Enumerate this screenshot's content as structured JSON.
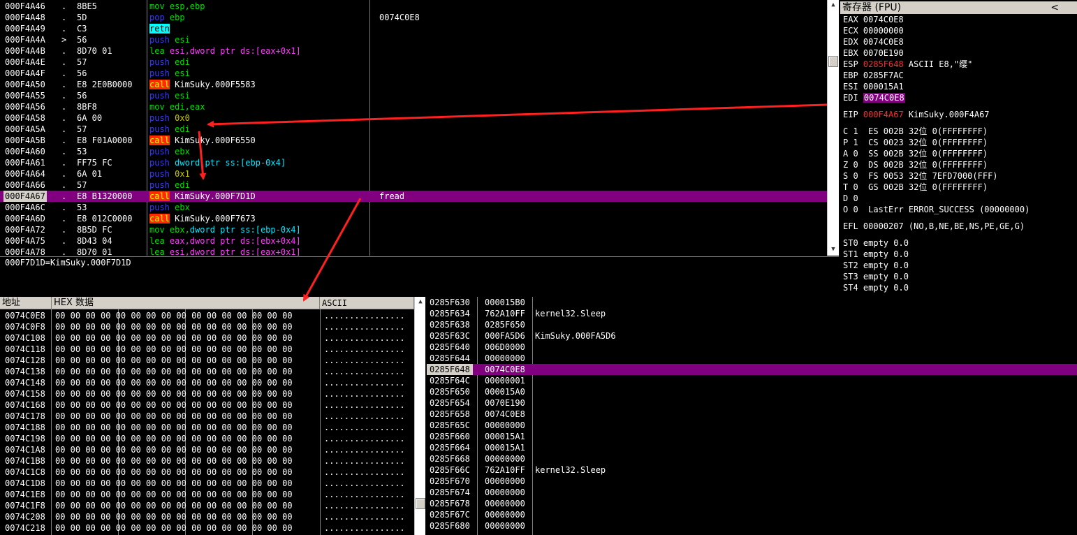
{
  "disasm": {
    "rows": [
      {
        "addr": "000F4A46",
        "mark": ".",
        "hex": "8BE5",
        "ins": [
          {
            "t": "mov esp,ebp",
            "c": "kw-g"
          }
        ],
        "comment": ""
      },
      {
        "addr": "000F4A48",
        "mark": ".",
        "hex": "5D",
        "ins": [
          {
            "t": "pop ebp",
            "c": "kw-b",
            "split": true
          }
        ],
        "comment": "0074C0E8"
      },
      {
        "addr": "000F4A49",
        "mark": ".",
        "hex": "C3",
        "ins": [
          {
            "t": "retn",
            "c": "retn-hl"
          }
        ],
        "comment": ""
      },
      {
        "addr": "000F4A4A",
        "mark": ">",
        "hex": "56",
        "ins": [
          {
            "t": "push esi",
            "c": "kw-b",
            "split": true
          }
        ],
        "comment": ""
      },
      {
        "addr": "000F4A4B",
        "mark": ".",
        "hex": "8D70 01",
        "ins": [
          {
            "t": "lea esi,dword ptr ds:[eax+0x1]",
            "c": "kw-m"
          }
        ],
        "comment": ""
      },
      {
        "addr": "000F4A4E",
        "mark": ".",
        "hex": "57",
        "ins": [
          {
            "t": "push edi",
            "c": "kw-b",
            "split": true
          }
        ],
        "comment": ""
      },
      {
        "addr": "000F4A4F",
        "mark": ".",
        "hex": "56",
        "ins": [
          {
            "t": "push esi",
            "c": "kw-b",
            "split": true
          }
        ],
        "comment": ""
      },
      {
        "addr": "000F4A50",
        "mark": ".",
        "hex": "E8 2E0B0000",
        "ins": [
          {
            "t": "call",
            "c": "call-hl"
          },
          {
            "t": " KimSuky.000F5583",
            "c": ""
          }
        ],
        "comment": ""
      },
      {
        "addr": "000F4A55",
        "mark": ".",
        "hex": "56",
        "ins": [
          {
            "t": "push esi",
            "c": "kw-b",
            "split": true
          }
        ],
        "comment": ""
      },
      {
        "addr": "000F4A56",
        "mark": ".",
        "hex": "8BF8",
        "ins": [
          {
            "t": "mov edi,eax",
            "c": "kw-g"
          }
        ],
        "comment": ""
      },
      {
        "addr": "000F4A58",
        "mark": ".",
        "hex": "6A 00",
        "ins": [
          {
            "t": "push ",
            "c": "kw-b"
          },
          {
            "t": "0x0",
            "c": "kw-y"
          }
        ],
        "comment": ""
      },
      {
        "addr": "000F4A5A",
        "mark": ".",
        "hex": "57",
        "ins": [
          {
            "t": "push edi",
            "c": "kw-b",
            "split": true
          }
        ],
        "comment": ""
      },
      {
        "addr": "000F4A5B",
        "mark": ".",
        "hex": "E8 F01A0000",
        "ins": [
          {
            "t": "call",
            "c": "call-hl"
          },
          {
            "t": " KimSuky.000F6550",
            "c": ""
          }
        ],
        "comment": ""
      },
      {
        "addr": "000F4A60",
        "mark": ".",
        "hex": "53",
        "ins": [
          {
            "t": "push ebx",
            "c": "kw-b",
            "split": true
          }
        ],
        "comment": ""
      },
      {
        "addr": "000F4A61",
        "mark": ".",
        "hex": "FF75 FC",
        "ins": [
          {
            "t": "push ",
            "c": "kw-b"
          },
          {
            "t": "dword ptr ss:[ebp-0x4]",
            "c": "kw-c"
          }
        ],
        "comment": ""
      },
      {
        "addr": "000F4A64",
        "mark": ".",
        "hex": "6A 01",
        "ins": [
          {
            "t": "push ",
            "c": "kw-b"
          },
          {
            "t": "0x1",
            "c": "kw-y"
          }
        ],
        "comment": ""
      },
      {
        "addr": "000F4A66",
        "mark": ".",
        "hex": "57",
        "ins": [
          {
            "t": "push edi",
            "c": "kw-b",
            "split": true
          }
        ],
        "comment": ""
      },
      {
        "addr": "000F4A67",
        "mark": ".",
        "hex": "E8 B1320000",
        "ins": [
          {
            "t": "call",
            "c": "call-hl"
          },
          {
            "t": " KimSuky.000F7D1D",
            "c": ""
          }
        ],
        "comment": "fread",
        "selected": true
      },
      {
        "addr": "000F4A6C",
        "mark": ".",
        "hex": "53",
        "ins": [
          {
            "t": "push ebx",
            "c": "kw-b",
            "split": true
          }
        ],
        "comment": ""
      },
      {
        "addr": "000F4A6D",
        "mark": ".",
        "hex": "E8 012C0000",
        "ins": [
          {
            "t": "call",
            "c": "call-hl"
          },
          {
            "t": " KimSuky.000F7673",
            "c": ""
          }
        ],
        "comment": ""
      },
      {
        "addr": "000F4A72",
        "mark": ".",
        "hex": "8B5D FC",
        "ins": [
          {
            "t": "mov ebx,dword ptr ss:[ebp-0x4]",
            "c": "kw-g"
          }
        ],
        "comment": ""
      },
      {
        "addr": "000F4A75",
        "mark": ".",
        "hex": "8D43 04",
        "ins": [
          {
            "t": "lea eax,dword ptr ds:[ebx+0x4]",
            "c": "kw-m"
          }
        ],
        "comment": ""
      },
      {
        "addr": "000F4A78",
        "mark": ".",
        "hex": "8D70 01",
        "ins": [
          {
            "t": "lea esi,dword ptr ds:[eax+0x1]",
            "c": "kw-m"
          }
        ],
        "comment": ""
      }
    ]
  },
  "info_line": "000F7D1D=KimSuky.000F7D1D",
  "registers": {
    "title": "寄存器 (FPU)",
    "collapse": "<",
    "gp": [
      {
        "n": "EAX",
        "v": "0074C0E8",
        "x": ""
      },
      {
        "n": "ECX",
        "v": "00000000",
        "x": ""
      },
      {
        "n": "EDX",
        "v": "0074C0E8",
        "x": ""
      },
      {
        "n": "EBX",
        "v": "0070E190",
        "x": ""
      },
      {
        "n": "ESP",
        "v": "0285F648",
        "x": "ASCII E8,\"缨\"",
        "red": true
      },
      {
        "n": "EBP",
        "v": "0285F7AC",
        "x": ""
      },
      {
        "n": "ESI",
        "v": "000015A1",
        "x": ""
      },
      {
        "n": "EDI",
        "v": "0074C0E8",
        "x": "",
        "hl": true
      }
    ],
    "eip": {
      "n": "EIP",
      "v": "000F4A67",
      "x": "KimSuky.000F4A67"
    },
    "flags": [
      "C 1  ES 002B 32位 0(FFFFFFFF)",
      "P 1  CS 0023 32位 0(FFFFFFFF)",
      "A 0  SS 002B 32位 0(FFFFFFFF)",
      "Z 0  DS 002B 32位 0(FFFFFFFF)",
      "S 0  FS 0053 32位 7EFD7000(FFF)",
      "T 0  GS 002B 32位 0(FFFFFFFF)",
      "D 0",
      "O 0  LastErr ERROR_SUCCESS (00000000)"
    ],
    "efl": "EFL 00000207 (NO,B,NE,BE,NS,PE,GE,G)",
    "fpu": [
      "ST0 empty 0.0",
      "ST1 empty 0.0",
      "ST2 empty 0.0",
      "ST3 empty 0.0",
      "ST4 empty 0.0"
    ]
  },
  "dump": {
    "col_addr": "地址",
    "col_hex": "HEX 数据",
    "col_ascii": "ASCII",
    "hex_line": "00 00 00 00 00 00 00 00 00 00 00 00 00 00 00 00",
    "ascii_line": "................",
    "addrs": [
      "0074C0E8",
      "0074C0F8",
      "0074C108",
      "0074C118",
      "0074C128",
      "0074C138",
      "0074C148",
      "0074C158",
      "0074C168",
      "0074C178",
      "0074C188",
      "0074C198",
      "0074C1A8",
      "0074C1B8",
      "0074C1C8",
      "0074C1D8",
      "0074C1E8",
      "0074C1F8",
      "0074C208",
      "0074C218"
    ]
  },
  "stack": {
    "rows": [
      {
        "a": "0285F630",
        "v": "000015B0",
        "c": ""
      },
      {
        "a": "0285F634",
        "v": "762A10FF",
        "c": "kernel32.Sleep"
      },
      {
        "a": "0285F638",
        "v": "0285F650",
        "c": ""
      },
      {
        "a": "0285F63C",
        "v": "000FA5D6",
        "c": "KimSuky.000FA5D6"
      },
      {
        "a": "0285F640",
        "v": "006D0000",
        "c": ""
      },
      {
        "a": "0285F644",
        "v": "00000000",
        "c": ""
      },
      {
        "a": "0285F648",
        "v": "0074C0E8",
        "c": "",
        "selected": true
      },
      {
        "a": "0285F64C",
        "v": "00000001",
        "c": ""
      },
      {
        "a": "0285F650",
        "v": "000015A0",
        "c": ""
      },
      {
        "a": "0285F654",
        "v": "0070E190",
        "c": ""
      },
      {
        "a": "0285F658",
        "v": "0074C0E8",
        "c": ""
      },
      {
        "a": "0285F65C",
        "v": "00000000",
        "c": ""
      },
      {
        "a": "0285F660",
        "v": "000015A1",
        "c": ""
      },
      {
        "a": "0285F664",
        "v": "000015A1",
        "c": ""
      },
      {
        "a": "0285F668",
        "v": "00000000",
        "c": ""
      },
      {
        "a": "0285F66C",
        "v": "762A10FF",
        "c": "kernel32.Sleep"
      },
      {
        "a": "0285F670",
        "v": "00000000",
        "c": ""
      },
      {
        "a": "0285F674",
        "v": "00000000",
        "c": ""
      },
      {
        "a": "0285F678",
        "v": "00000000",
        "c": ""
      },
      {
        "a": "0285F67C",
        "v": "00000000",
        "c": ""
      },
      {
        "a": "0285F680",
        "v": "00000000",
        "c": ""
      }
    ]
  },
  "colors": {
    "arrow": "#ff2020",
    "selection": "#800080",
    "call": "#ff2a00"
  }
}
